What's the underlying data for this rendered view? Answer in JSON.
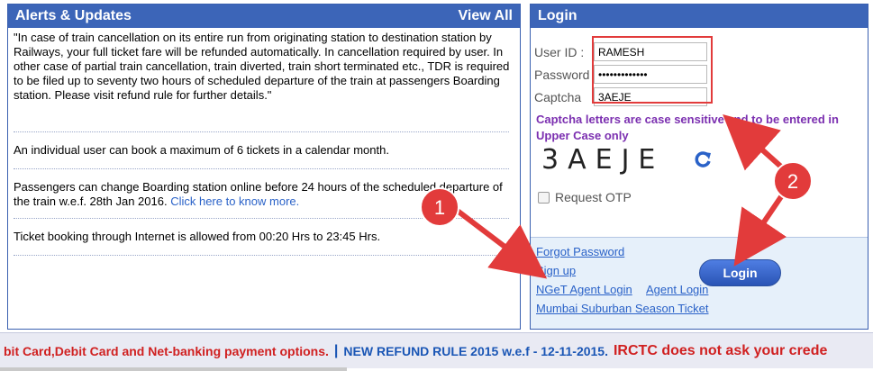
{
  "alerts": {
    "title": "Alerts & Updates",
    "view_all": "View All",
    "items": [
      "\"In case of train cancellation on its entire run from originating station to destination station by Railways, your full ticket fare will be refunded automatically. In cancellation required by user. In other case of partial train cancellation, train diverted, train short terminated etc., TDR is required to be filed up to seventy two hours of scheduled departure of the train at passengers Boarding station. Please visit refund rule for further details.\"",
      "An individual user can book a maximum of 6 tickets in a calendar month.",
      "Passengers can change Boarding station online before 24 hours of the scheduled departure of the train w.e.f. 28th Jan 2016.",
      "Ticket booking through Internet is allowed from 00:20 Hrs to 23:45 Hrs."
    ],
    "know_more": "Click here to know more."
  },
  "login": {
    "title": "Login",
    "userid_label": "User ID :",
    "userid_value": "RAMESH",
    "password_label": "Password",
    "password_value": "•••••••••••••",
    "captcha_label": "Captcha",
    "captcha_value": "3AEJE",
    "captcha_note": "Captcha letters are case sensitive and to be entered in Upper Case only",
    "captcha_text": "3AEJE",
    "request_otp": "Request OTP",
    "forgot_password": "Forgot Password",
    "sign_up": "Sign up",
    "nget_agent": "NGeT Agent Login",
    "agent_login": "Agent Login",
    "mumbai": "Mumbai Suburban Season Ticket",
    "login_button": "Login"
  },
  "ticker": {
    "part1": "bit Card,Debit Card and Net-banking payment options.",
    "sep": "|",
    "part2": "NEW REFUND RULE 2015 w.e.f - 12-11-2015.",
    "part3": "IRCTC does not ask your crede"
  },
  "annotations": [
    "1",
    "2"
  ],
  "colors": {
    "header": "#3c65b8",
    "highlight": "#e23b3b",
    "captcha_note": "#7b2fb0",
    "link": "#2a62c8"
  }
}
